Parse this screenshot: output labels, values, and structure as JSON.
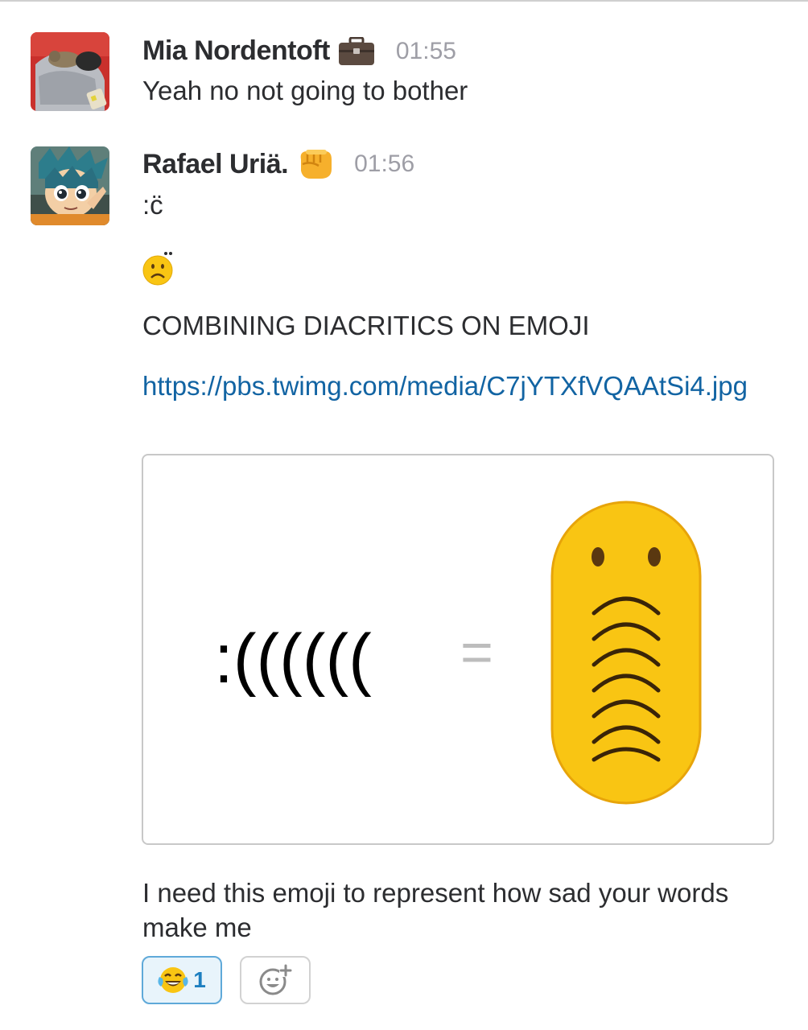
{
  "messages": [
    {
      "author": "Mia Nordentoft",
      "status_icon": "briefcase-icon",
      "time": "01:55",
      "text": "Yeah no not going to bother"
    },
    {
      "author": "Rafael Uriä.",
      "status_icon": "fist-icon",
      "time": "01:56",
      "lines": [
        ":c̈",
        "combining-diaeresis-frowning-face-emoji",
        "COMBINING DIACRITICS ON EMOJI"
      ],
      "link": "https://pbs.twimg.com/media/C7jYTXfVQAAtSi4.jpg",
      "attachment": {
        "left_text": ":((((((",
        "equals": "=",
        "emoji": "tall-sad-face-emoji"
      },
      "text": "I need this emoji to represent how sad your words make me",
      "reactions": [
        {
          "emoji": "laughing-crying-face-icon",
          "count": "1"
        }
      ]
    }
  ],
  "colors": {
    "link": "#1264a3",
    "timestamp": "#9e9ea6",
    "reaction_border": "#5fa9d9",
    "reaction_bg": "#e8f4fb",
    "emoji_yellow": "#f9c513"
  }
}
